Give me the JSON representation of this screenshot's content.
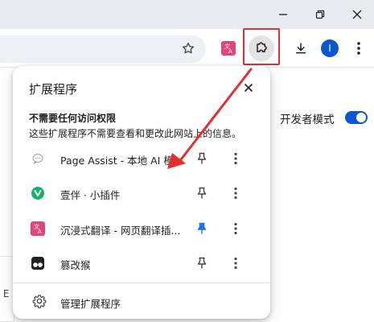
{
  "window_controls": {
    "minimize_icon": "minimize-icon",
    "restore_icon": "restore-icon",
    "close_icon": "close-icon"
  },
  "toolbar": {
    "bookmark_icon": "star-icon",
    "translate_extension_icon": "translate-icon",
    "extensions_icon": "puzzle-icon",
    "downloads_icon": "download-icon",
    "profile_initial": "I",
    "menu_icon": "kebab-menu-icon",
    "profile_color": "#0b57d0"
  },
  "page": {
    "developer_mode_label": "开发者模式",
    "developer_mode_on": true,
    "partial_text": " E"
  },
  "popup": {
    "title": "扩展程序",
    "close_icon": "close-icon",
    "section_title": "不需要任何访问权限",
    "section_desc": "这些扩展程序不需要查看和更改此网站上的信息。",
    "extensions": [
      {
        "name": "Page Assist - 本地 AI 模...",
        "icon": "chat-bubble-icon",
        "pinned": false
      },
      {
        "name": "壹伴 · 小插件",
        "icon": "yiban-icon",
        "pinned": false
      },
      {
        "name": "沉浸式翻译 - 网页翻译插...",
        "icon": "immersive-translate-icon",
        "pinned": true
      },
      {
        "name": "篡改猴",
        "icon": "tampermonkey-icon",
        "pinned": false
      }
    ],
    "manage_label": "管理扩展程序",
    "manage_icon": "gear-icon"
  },
  "colors": {
    "accent": "#0b57d0",
    "annotation_red": "#e03030",
    "pin_active": "#1a73e8"
  }
}
